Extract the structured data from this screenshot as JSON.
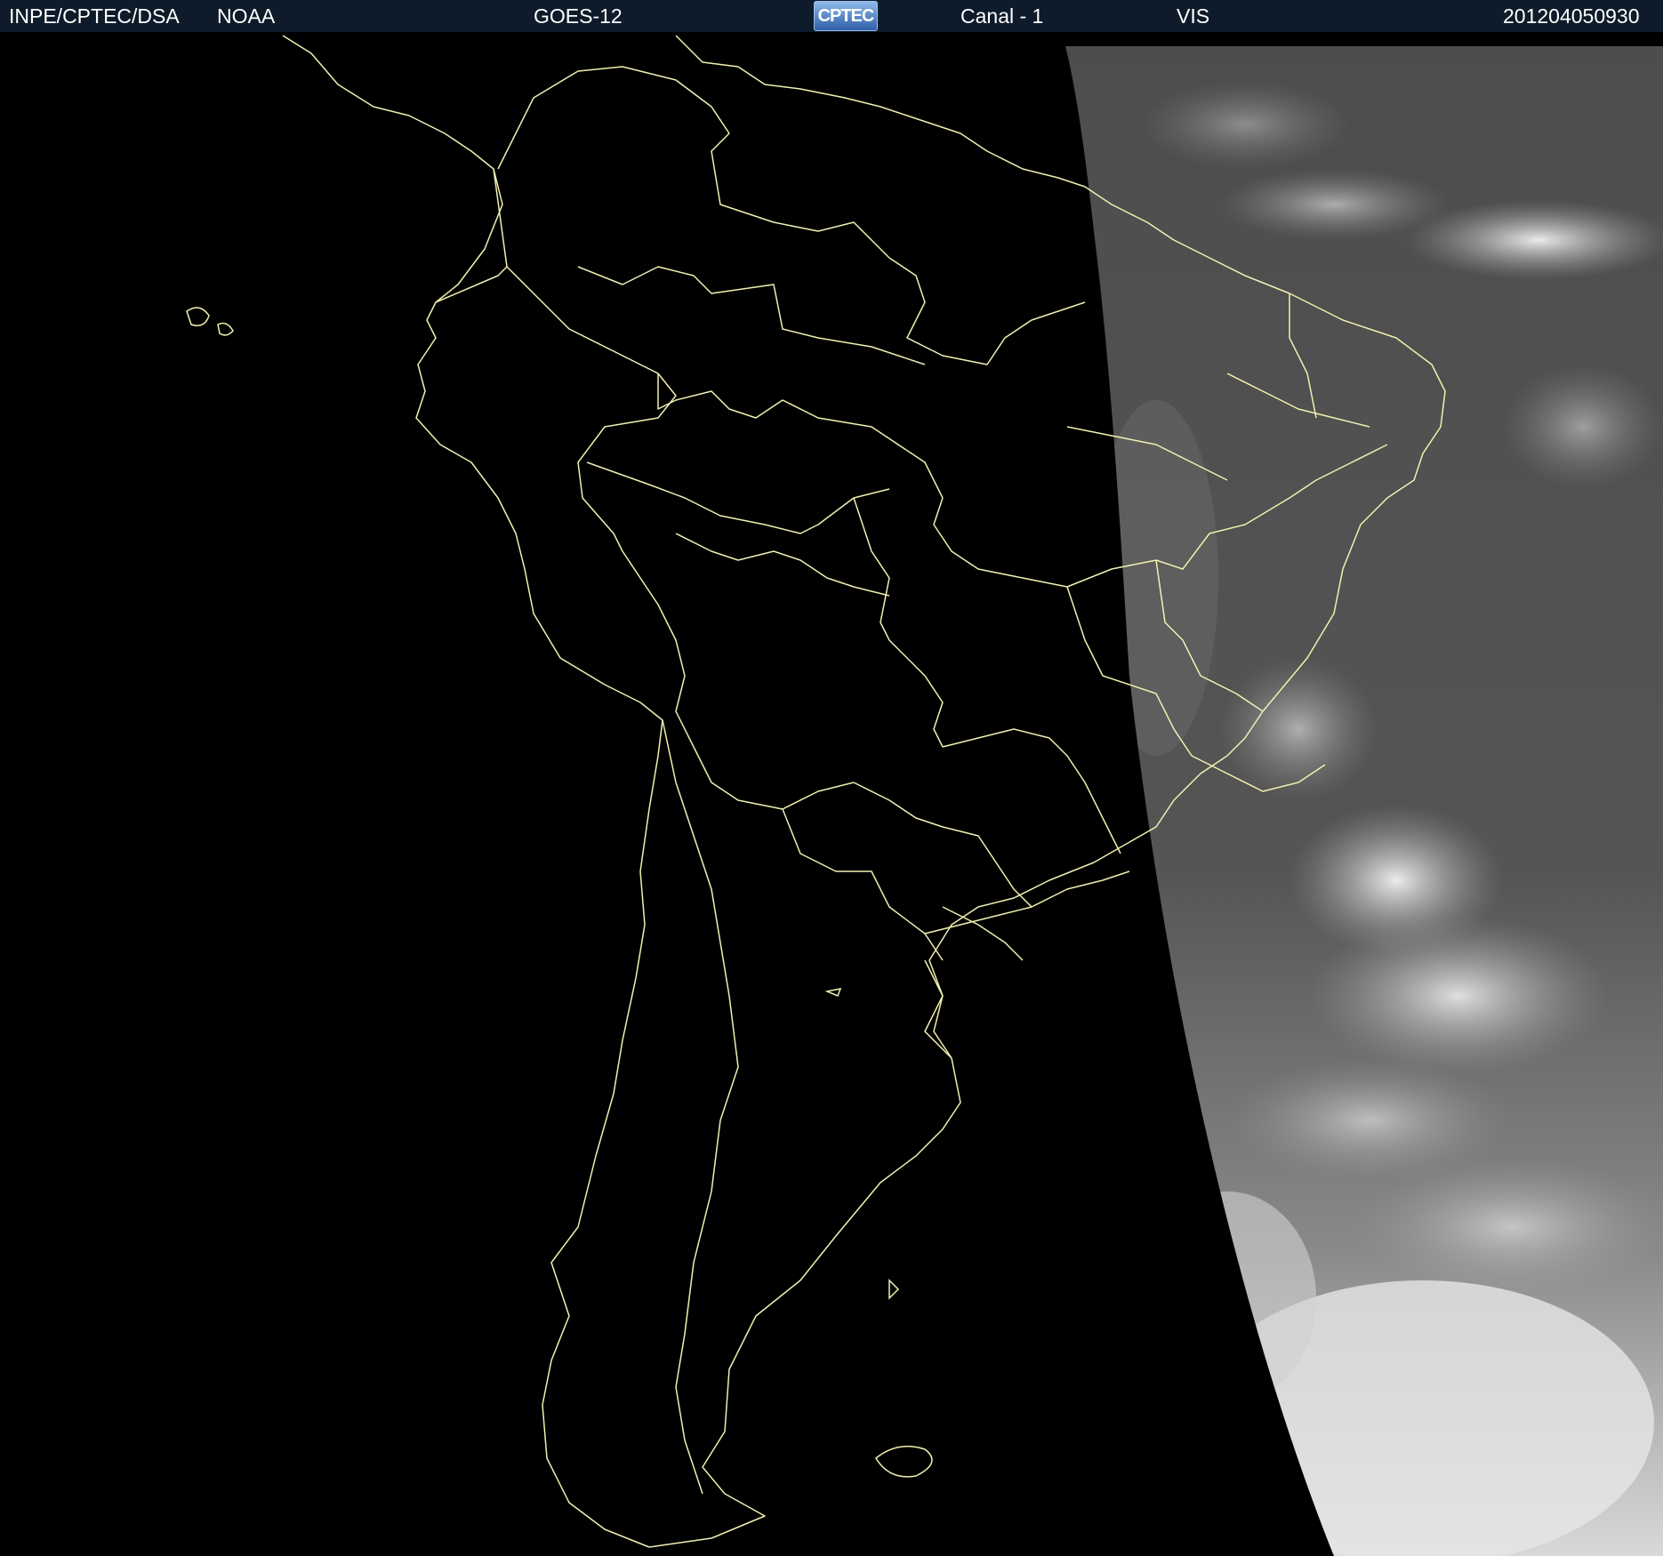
{
  "header": {
    "agency": "INPE/CPTEC/DSA",
    "source": "NOAA",
    "satellite": "GOES-12",
    "logo_text": "CPTEC",
    "channel": "Canal - 1",
    "band": "VIS",
    "timestamp": "201204050930"
  },
  "colors": {
    "header_bg": "#0d1b2a",
    "boundary_lines": "#f2f0b0",
    "space": "#000000",
    "cloud_bright": "#e8e8e8",
    "earth_dark": "#4a4a4a"
  }
}
